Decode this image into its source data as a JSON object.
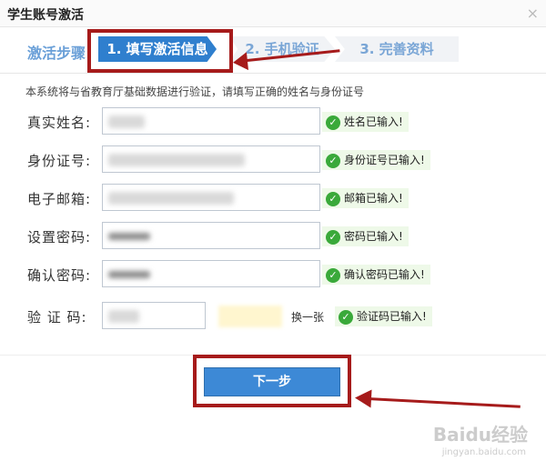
{
  "window": {
    "title": "学生账号激活",
    "close_glyph": "×"
  },
  "steps": {
    "label": "激活步骤",
    "items": [
      {
        "label": "1. 填写激活信息",
        "active": true
      },
      {
        "label": "2. 手机验证",
        "active": false
      },
      {
        "label": "3. 完善资料",
        "active": false
      }
    ]
  },
  "notice": "本系统将与省教育厅基础数据进行验证，请填写正确的姓名与身份证号",
  "form": {
    "rows": [
      {
        "label": "真实姓名:",
        "status": "姓名已输入!"
      },
      {
        "label": "身份证号:",
        "status": "身份证号已输入!"
      },
      {
        "label": "电子邮箱:",
        "status": "邮箱已输入!"
      },
      {
        "label": "设置密码:",
        "status": "密码已输入!"
      },
      {
        "label": "确认密码:",
        "status": "确认密码已输入!"
      }
    ],
    "captcha": {
      "label": "验 证 码:",
      "refresh": "换一张",
      "status": "验证码已输入!"
    }
  },
  "next_button": "下一步",
  "watermark": {
    "brand": "Baidu经验",
    "url": "jingyan.baidu.com"
  },
  "colors": {
    "accent": "#2f7fce",
    "annotation": "#a61b1b",
    "success": "#3aa93a"
  }
}
